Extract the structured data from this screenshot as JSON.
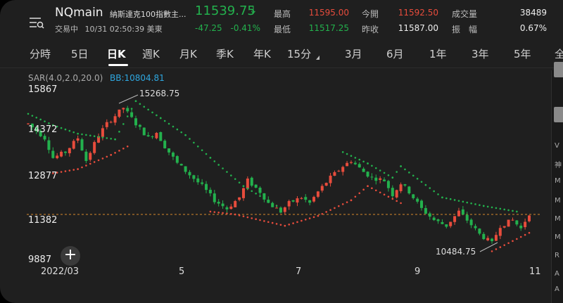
{
  "header": {
    "symbol": "NQmain",
    "name": "納斯達克100指數主...",
    "price": "11539.75",
    "arrow": "↓",
    "status": "交易中",
    "datetime": "10/31 02:50:39 美東",
    "change": "-47.25",
    "change_pct": "-0.41%"
  },
  "stats": {
    "high_label": "最高",
    "high": "11595.00",
    "low_label": "最低",
    "low": "11517.25",
    "open_label": "今開",
    "open": "11592.50",
    "prev_close_label": "昨收",
    "prev_close": "11587.00",
    "volume_label": "成交量",
    "volume": "38489",
    "amplitude_label": "振　幅",
    "amplitude": "0.67%"
  },
  "tabs": [
    {
      "label": "分時"
    },
    {
      "label": "5日"
    },
    {
      "label": "日K"
    },
    {
      "label": "週K"
    },
    {
      "label": "月K"
    },
    {
      "label": "季K"
    },
    {
      "label": "年K"
    },
    {
      "label": "15分"
    },
    {
      "label": "3月"
    },
    {
      "label": "6月"
    },
    {
      "label": "1年"
    },
    {
      "label": "3年"
    },
    {
      "label": "5年"
    },
    {
      "label": "全"
    }
  ],
  "indicators": {
    "sar": "SAR(4.0,2.0,20.0)",
    "bb": "BB:10804.81"
  },
  "chart_data": {
    "type": "candlestick",
    "y_ticks": [
      "15867",
      "14372",
      "12877",
      "11382",
      "9887"
    ],
    "x_ticks": [
      "2022/03",
      "5",
      "7",
      "9",
      "11"
    ],
    "ylim": [
      9887,
      15867
    ],
    "current_price": 11539.75,
    "high_annotation": "15268.75",
    "low_annotation": "10484.75",
    "path_points": [
      [
        0,
        14700
      ],
      [
        4,
        14200
      ],
      [
        6,
        13500
      ],
      [
        9,
        13700
      ],
      [
        12,
        14200
      ],
      [
        14,
        13400
      ],
      [
        17,
        14300
      ],
      [
        19,
        14700
      ],
      [
        23,
        15268.75
      ],
      [
        26,
        14700
      ],
      [
        29,
        14200
      ],
      [
        31,
        14400
      ],
      [
        33,
        13900
      ],
      [
        36,
        13300
      ],
      [
        39,
        12900
      ],
      [
        42,
        12500
      ],
      [
        45,
        12000
      ],
      [
        48,
        11700
      ],
      [
        51,
        12100
      ],
      [
        53,
        12700
      ],
      [
        56,
        12300
      ],
      [
        58,
        11900
      ],
      [
        61,
        11600
      ],
      [
        63,
        11900
      ],
      [
        66,
        12100
      ],
      [
        68,
        11900
      ],
      [
        70,
        12300
      ],
      [
        73,
        12800
      ],
      [
        76,
        13200
      ],
      [
        78,
        13400
      ],
      [
        81,
        13000
      ],
      [
        83,
        12800
      ],
      [
        86,
        12700
      ],
      [
        88,
        12200
      ],
      [
        90,
        12600
      ],
      [
        92,
        12300
      ],
      [
        95,
        11700
      ],
      [
        98,
        11300
      ],
      [
        101,
        11100
      ],
      [
        104,
        11600
      ],
      [
        106,
        11300
      ],
      [
        109,
        10800
      ],
      [
        112,
        10484.75
      ],
      [
        114,
        11100
      ],
      [
        117,
        11300
      ],
      [
        119,
        11000
      ],
      [
        121,
        11539.75
      ]
    ],
    "sar_above": [
      [
        0,
        15050
      ],
      [
        6,
        14650
      ],
      [
        12,
        14350
      ],
      [
        21,
        14150
      ],
      [
        26,
        15500
      ],
      [
        32,
        14900
      ],
      [
        38,
        14300
      ],
      [
        44,
        13500
      ],
      [
        52,
        12500
      ],
      [
        60,
        11800
      ],
      [
        76,
        13700
      ],
      [
        82,
        13300
      ],
      [
        88,
        12800
      ],
      [
        90,
        13200
      ],
      [
        100,
        12100
      ],
      [
        110,
        11800
      ],
      [
        118,
        11600
      ]
    ],
    "sar_below": [
      [
        6,
        12950
      ],
      [
        12,
        13100
      ],
      [
        20,
        13600
      ],
      [
        24,
        13900
      ],
      [
        44,
        11600
      ],
      [
        50,
        11500
      ],
      [
        62,
        11100
      ],
      [
        70,
        11450
      ],
      [
        78,
        12000
      ],
      [
        82,
        12500
      ],
      [
        90,
        11900
      ],
      [
        112,
        10200
      ],
      [
        121,
        10850
      ]
    ]
  },
  "right_pane": {
    "items": [
      "V",
      "神",
      "M",
      "M",
      "M",
      "M",
      "R",
      "A",
      "A"
    ]
  }
}
